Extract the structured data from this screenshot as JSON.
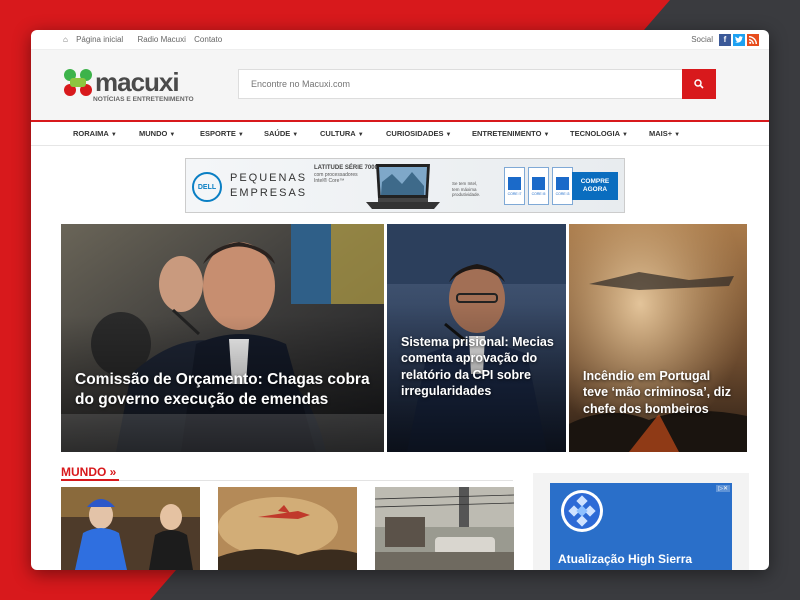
{
  "topbar": {
    "links": [
      {
        "icon": "home-icon",
        "label": "Página inicial"
      },
      {
        "label": "Radio Macuxi"
      },
      {
        "label": "Contato"
      }
    ],
    "social_label": "Social",
    "social": [
      {
        "icon": "facebook-icon",
        "glyph": "f",
        "color": "#3b5998"
      },
      {
        "icon": "twitter-icon",
        "glyph": "t",
        "color": "#1da1f2"
      },
      {
        "icon": "rss-icon",
        "glyph": "◉",
        "color": "#e74c1c"
      }
    ]
  },
  "logo": {
    "name": "macuxi",
    "tagline": "NOTÍCIAS E ENTRETENIMENTO"
  },
  "search": {
    "placeholder": "Encontre no Macuxi.com"
  },
  "nav": {
    "items": [
      "RORAIMA",
      "MUNDO",
      "ESPORTE",
      "SAÚDE",
      "CULTURA",
      "CURIOSIDADES",
      "ENTRETENIMENTO",
      "TECNOLOGIA",
      "MAIS+"
    ]
  },
  "ad": {
    "brand": "DELL",
    "line1": "PEQUENAS",
    "line2": "EMPRESAS",
    "product": "LATITUDE SÉRIE 7000",
    "product_sub1": "com processadores",
    "product_sub2": "Intel® Core™",
    "intel_note1": "Se tem Intel,",
    "intel_note2": "tem máxima",
    "intel_note3": "produtividade.",
    "chips": [
      "CORE i7",
      "CORE i5",
      "CORE i3"
    ],
    "cta_line1": "COMPRE",
    "cta_line2": "AGORA"
  },
  "hero": [
    {
      "title": "Comissão de Orçamento: Chagas cobra do governo execução de emendas"
    },
    {
      "title": "Sistema prisional: Mecias comenta aprovação do relatório da CPI sobre irregularidades"
    },
    {
      "title": "Incêndio em Portugal teve ‘mão criminosa’, diz chefe dos bombeiros"
    }
  ],
  "section": {
    "title": "MUNDO »"
  },
  "sidebar_ad": {
    "text": "Atualização High Sierra"
  },
  "colors": {
    "accent": "#d8191c",
    "dark_bg": "#3a3b3f"
  }
}
